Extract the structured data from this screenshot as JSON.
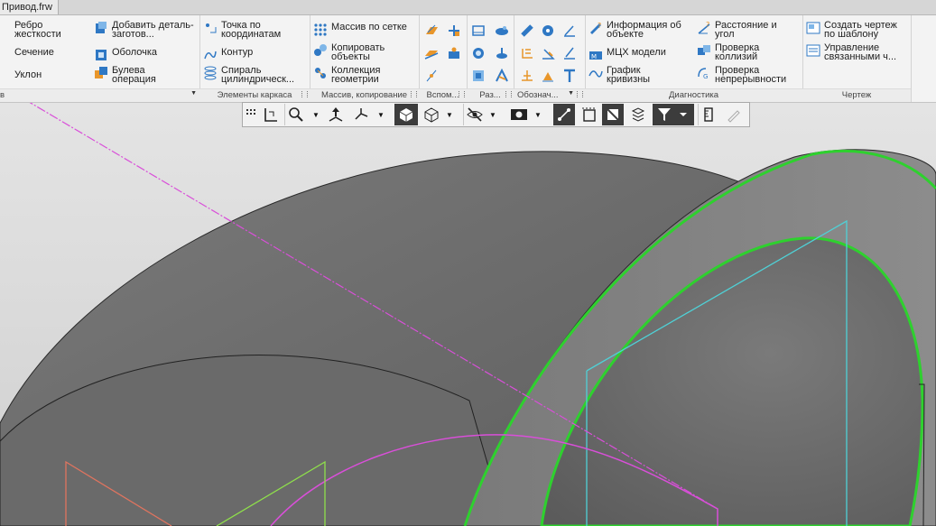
{
  "document_tab": "Привод.frw",
  "ribbon": {
    "groups": {
      "g1": {
        "label": "в",
        "commands": [
          "Ребро жесткости",
          "Сечение",
          "Уклон",
          "Добавить деталь-заготов...",
          "Оболочка",
          "Булева операция"
        ]
      },
      "g2": {
        "label": "Элементы каркаса",
        "commands": [
          "Точка по координатам",
          "Контур",
          "Спираль цилиндрическ..."
        ]
      },
      "g3": {
        "label": "Массив, копирование",
        "commands": [
          "Массив по сетке",
          "Копировать объекты",
          "Коллекция геометрии"
        ]
      },
      "g4": {
        "label": "Вспом..."
      },
      "g5": {
        "label": "Раз..."
      },
      "g6": {
        "label": "Обознач..."
      },
      "g7": {
        "label": "Диагностика",
        "commands": [
          "Информация об объекте",
          "МЦХ модели",
          "График кривизны",
          "Расстояние и угол",
          "Проверка коллизий",
          "Проверка непрерывности"
        ]
      },
      "g8": {
        "label": "Чертеж",
        "commands": [
          "Создать чертеж по шаблону",
          "Управление связанными ч..."
        ]
      }
    }
  },
  "icons": {
    "ribbon": [
      "rib-icon",
      "section-icon",
      "draft-icon",
      "add-blank-icon",
      "shell-icon",
      "boolean-icon",
      "point-icon",
      "contour-icon",
      "helix-icon",
      "grid-array-icon",
      "copy-objects-icon",
      "geometry-collection-icon",
      "info-icon",
      "mass-icon",
      "curvature-icon",
      "distance-icon",
      "collision-icon",
      "continuity-icon",
      "create-drawing-icon",
      "manage-drawings-icon",
      "text-icon"
    ],
    "toolbar": [
      "grip-icon",
      "orientation-icon",
      "zoom-icon",
      "pan-icon",
      "axis-icon",
      "shaded-view-icon",
      "wireframe-view-icon",
      "hide-icon",
      "display-icon",
      "perspective-icon",
      "section-view-icon",
      "filter-icon",
      "measure-icon",
      "pen-icon"
    ]
  },
  "colors": {
    "model_dark": "#6a6a6a",
    "model_light": "#8a8a8a",
    "highlight_green": "#2ed12e",
    "cyan_sketch": "#4fd1d6",
    "magenta_axis": "#d94fd9",
    "orange_sketch": "#e0745f",
    "lime_sketch": "#8fe04b"
  }
}
